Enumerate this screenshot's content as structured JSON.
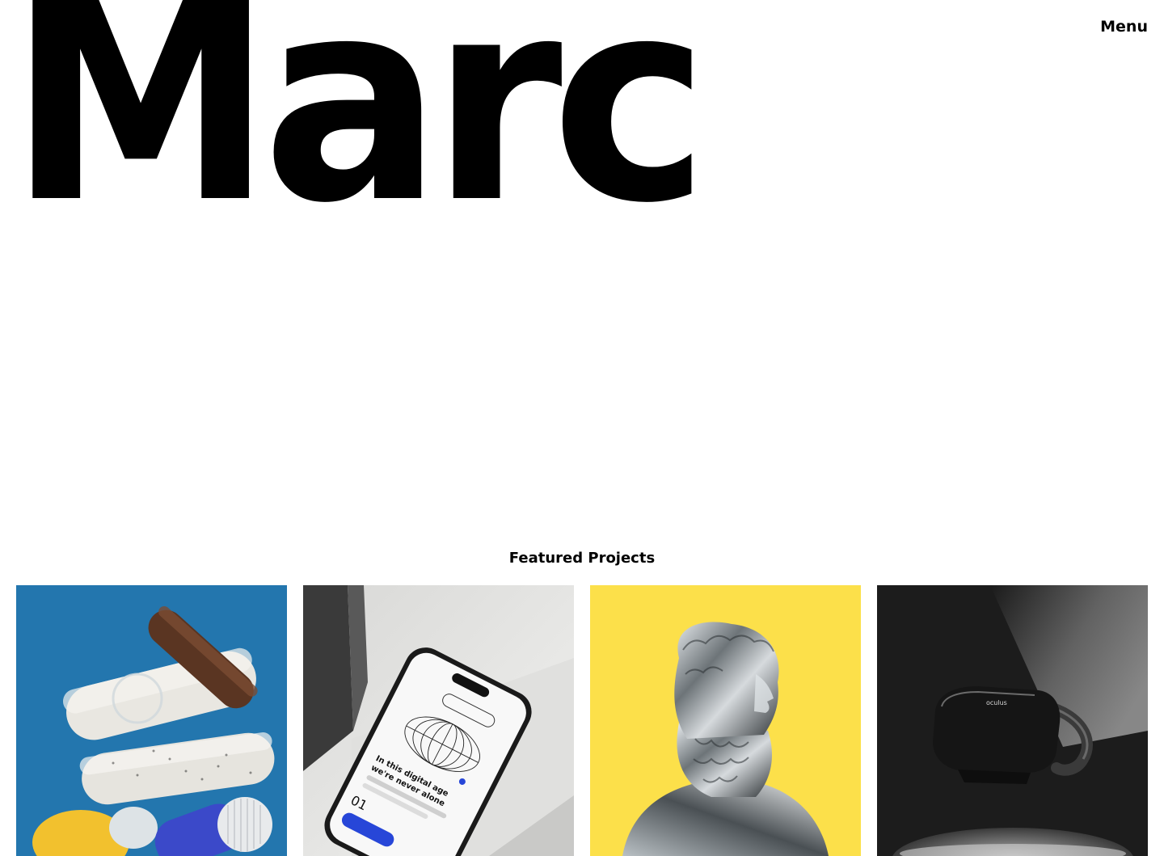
{
  "header": {
    "brand": "Marc",
    "menu_label": "Menu"
  },
  "featured": {
    "title": "Featured Projects",
    "projects": [
      {
        "id": "pills",
        "background": "#2376AE"
      },
      {
        "id": "phone",
        "background": "#E6E6E4",
        "screen_text_1": "In this digital age",
        "screen_text_2": "we're never alone",
        "screen_number": "01"
      },
      {
        "id": "statue",
        "background": "#FCE04A"
      },
      {
        "id": "oculus",
        "background": "#1C1C1C",
        "brand_mark": "oculus"
      }
    ]
  }
}
